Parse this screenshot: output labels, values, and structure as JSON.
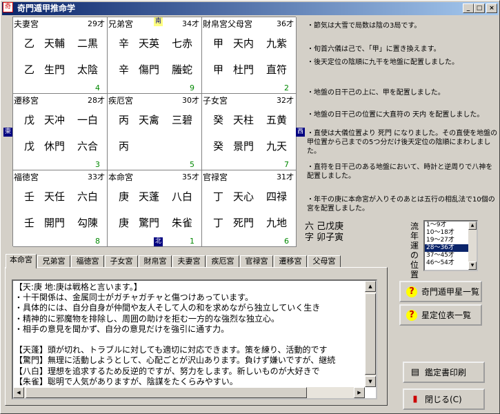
{
  "window": {
    "title": "奇門遁甲推命学",
    "app_icon": "奇",
    "min": "_",
    "max": "□",
    "close": "×"
  },
  "grid": {
    "cells": [
      {
        "name": "夫妻宮",
        "age": "29才",
        "r1": [
          "乙",
          "天輔",
          "二黒"
        ],
        "r2": [
          "乙",
          "生門",
          "太陰"
        ],
        "num": "4"
      },
      {
        "name": "兄弟宮",
        "age": "34才",
        "r1": [
          "辛",
          "天英",
          "七赤"
        ],
        "r2": [
          "辛",
          "傷門",
          "螣蛇"
        ],
        "num": "9"
      },
      {
        "name": "財帛宮父母宮",
        "age": "36才",
        "r1": [
          "甲",
          "天内",
          "九紫"
        ],
        "r2": [
          "甲",
          "杜門",
          "直符"
        ],
        "num": "2"
      },
      {
        "name": "遷移宮",
        "age": "28才",
        "r1": [
          "戊",
          "天冲",
          "一白"
        ],
        "r2": [
          "戊",
          "休門",
          "六合"
        ],
        "num": "3"
      },
      {
        "name": "疾厄宮",
        "age": "30才",
        "r1": [
          "丙",
          "天禽",
          "三碧"
        ],
        "r2": [
          "丙",
          "",
          ""
        ],
        "num": "5"
      },
      {
        "name": "子女宮",
        "age": "32才",
        "r1": [
          "癸",
          "天柱",
          "五黄"
        ],
        "r2": [
          "癸",
          "景門",
          "九天"
        ],
        "num": "7"
      },
      {
        "name": "福徳宮",
        "age": "33才",
        "r1": [
          "壬",
          "天任",
          "六白"
        ],
        "r2": [
          "壬",
          "開門",
          "勾陳"
        ],
        "num": "8"
      },
      {
        "name": "本命宮",
        "age": "35才",
        "r1": [
          "庚",
          "天蓬",
          "八白"
        ],
        "r2": [
          "庚",
          "驚門",
          "朱雀"
        ],
        "num": "1"
      },
      {
        "name": "官禄宮",
        "age": "31才",
        "r1": [
          "丁",
          "天心",
          "四禄"
        ],
        "r2": [
          "丁",
          "死門",
          "九地"
        ],
        "num": "6"
      }
    ],
    "dir_south": "南",
    "dir_east": "東",
    "dir_west": "西",
    "dir_north": "北"
  },
  "notes": [
    "・節気は大雪で局数は陰の3局です。",
    "・旬首六儀は己で、「甲」に置き換えます。",
    "・後天定位の陰順に九干を地盤に配置しました。",
    "・地盤の日干己の上に、甲を配置しました。",
    "・地盤の日干己の位置に大直符の 天内 を配置しました。",
    "・直使は大儀位置より 死門 になりました。その直使を地盤の甲位置から己までの5つ分だけ後天定位の陰順にまわしました。",
    "・直符を日干己のある地盤において、時計と逆周りで八神を配置しました。",
    "・年干の庚に本命宮が入りそのあとは五行の相乱法で10個の宮を配置しました。"
  ],
  "rikugi": {
    "l1a": "六",
    "l1b": "己戊庚",
    "l2a": "字",
    "l2b": "卯子寅"
  },
  "ryunen": {
    "label": "流年運の位置",
    "items": [
      "1〜9才",
      "10〜18才",
      "19〜27才",
      "28〜36才",
      "37〜45才",
      "46〜54才"
    ],
    "selected": 3
  },
  "tabs": [
    "本命宮",
    "兄弟宮",
    "福徳宮",
    "子女宮",
    "財帛宮",
    "夫妻宮",
    "疾厄宮",
    "官禄宮",
    "遷移宮",
    "父母宮"
  ],
  "active_tab": 0,
  "text_lines": [
    "【天:庚 地:庚は戦格と言います。】",
    "・十干関係は、金属同士がガチャガチャと傷つけあっています。",
    "・具体的には、自分自身が仲間や友人そして人の和を求めながら独立していく生き",
    "・精神的に邪魔物を排除し、周囲の助けを拒む一方的な強烈な独立心。",
    "・相手の意見を聞かず、自分の意見だけを強引に通す力。",
    "",
    "【天蓬】頭が切れ、トラブルに対しても適切に対応できます。策を練り、活動的です",
    "【驚門】無理に活動しようとして、心配ごとが沢山あります。負けず嫌いですが、継続",
    "【八白】理想を追求するため反逆的ですが、努力をします。新しいものが大好きで",
    "【朱雀】聡明で人気がありますが、陰謀をたくらみやすい。"
  ],
  "buttons": {
    "list1": "奇門遁甲星一覧",
    "list2": "星定位表一覧",
    "print": "鑑定書印刷",
    "close": "閉じる(C)"
  },
  "icons": {
    "help": "?",
    "print": "▤",
    "exit": "▮"
  }
}
